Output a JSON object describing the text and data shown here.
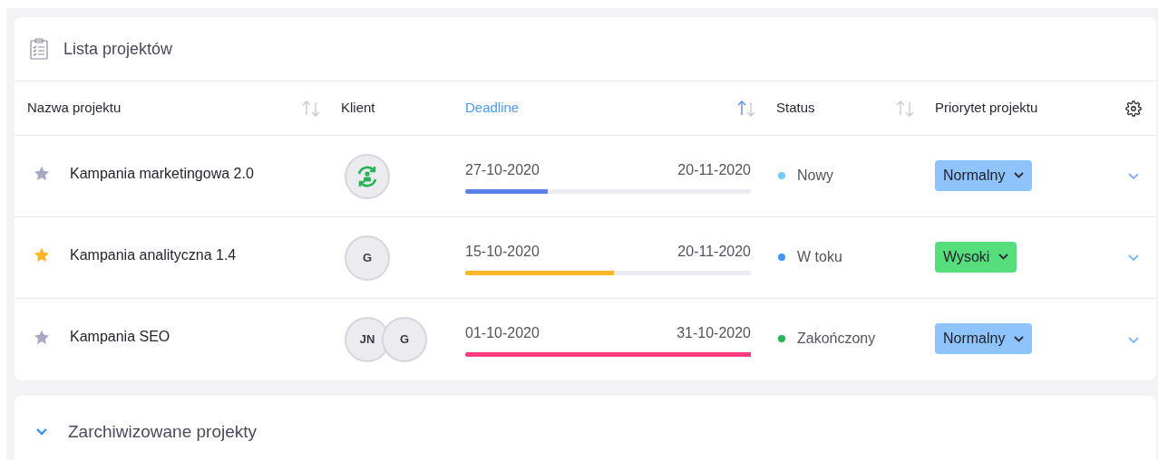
{
  "card": {
    "title": "Lista projektów"
  },
  "columns": [
    {
      "label": "Nazwa projektu",
      "sortable": true,
      "sorted": false
    },
    {
      "label": "Klient",
      "sortable": false,
      "sorted": false
    },
    {
      "label": "Deadline",
      "sortable": true,
      "sorted": true
    },
    {
      "label": "Status",
      "sortable": true,
      "sorted": false
    },
    {
      "label": "Priorytet projektu",
      "sortable": false,
      "sorted": false
    }
  ],
  "rows": [
    {
      "starred": false,
      "name": "Kampania marketingowa 2.0",
      "clients": [
        {
          "kind": "icon"
        }
      ],
      "start": "27-10-2020",
      "end": "20-11-2020",
      "progress": {
        "level": 0.29,
        "color": "#5b7fe8"
      },
      "status": {
        "label": "Nowy",
        "color": "#6fcdf7"
      },
      "priority": {
        "label": "Normalny",
        "color": "#8fc3fc"
      }
    },
    {
      "starred": true,
      "name": "Kampania analityczna 1.4",
      "clients": [
        {
          "kind": "initials",
          "text": "G"
        }
      ],
      "start": "15-10-2020",
      "end": "20-11-2020",
      "progress": {
        "level": 0.52,
        "color": "#fbb728"
      },
      "status": {
        "label": "W toku",
        "color": "#3d97f7"
      },
      "priority": {
        "label": "Wysoki",
        "color": "#57de7c"
      }
    },
    {
      "starred": false,
      "name": "Kampania SEO",
      "clients": [
        {
          "kind": "initials",
          "text": "JN"
        },
        {
          "kind": "initials",
          "text": "G"
        }
      ],
      "start": "01-10-2020",
      "end": "31-10-2020",
      "progress": {
        "level": 1.0,
        "color": "#fb3b7d"
      },
      "status": {
        "label": "Zakończony",
        "color": "#27b455"
      },
      "priority": {
        "label": "Normalny",
        "color": "#8fc3fc"
      }
    }
  ],
  "archive": {
    "title": "Zarchiwizowane projekty",
    "expanded": false
  }
}
